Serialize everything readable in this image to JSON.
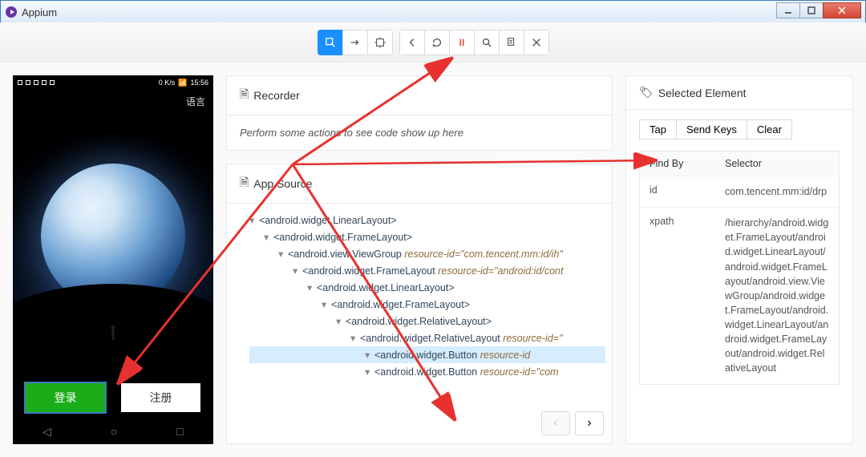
{
  "window": {
    "title": "Appium"
  },
  "toolbar": {
    "buttons": [
      {
        "name": "select-element-icon"
      },
      {
        "name": "swipe-icon"
      },
      {
        "name": "tap-coords-icon"
      },
      {
        "name": "back-icon"
      },
      {
        "name": "refresh-icon"
      },
      {
        "name": "record-icon"
      },
      {
        "name": "search-icon"
      },
      {
        "name": "copy-icon"
      },
      {
        "name": "close-session-icon"
      }
    ]
  },
  "phone": {
    "status_speed": "0 K/s",
    "status_time": "15:56",
    "lang_label": "语言",
    "login_label": "登录",
    "register_label": "注册"
  },
  "recorder": {
    "title": "Recorder",
    "empty_text": "Perform some actions to see code show up here"
  },
  "source": {
    "title": "App Source",
    "tree": [
      {
        "indent": 0,
        "tag": "<android.widget.LinearLayout>",
        "attr": ""
      },
      {
        "indent": 1,
        "tag": "<android.widget.FrameLayout>",
        "attr": ""
      },
      {
        "indent": 2,
        "tag": "<android.view.ViewGroup ",
        "attr": "resource-id=\"com.tencent.mm:id/ih\""
      },
      {
        "indent": 3,
        "tag": "<android.widget.FrameLayout ",
        "attr": "resource-id=\"android:id/cont"
      },
      {
        "indent": 4,
        "tag": "<android.widget.LinearLayout>",
        "attr": ""
      },
      {
        "indent": 5,
        "tag": "<android.widget.FrameLayout>",
        "attr": ""
      },
      {
        "indent": 6,
        "tag": "<android.widget.RelativeLayout>",
        "attr": ""
      },
      {
        "indent": 7,
        "tag": "<android.widget.RelativeLayout ",
        "attr": "resource-id=\""
      },
      {
        "indent": 8,
        "tag": "<android.widget.Button ",
        "attr": "resource-id",
        "selected": true
      },
      {
        "indent": 8,
        "tag": "<android.widget.Button ",
        "attr": "resource-id=\"com"
      }
    ]
  },
  "selected": {
    "title": "Selected Element",
    "actions": {
      "tap": "Tap",
      "send_keys": "Send Keys",
      "clear": "Clear"
    },
    "findby_h": "Find By",
    "selector_h": "Selector",
    "rows": [
      {
        "k": "id",
        "v": "com.tencent.mm:id/drp"
      },
      {
        "k": "xpath",
        "v": "/hierarchy/android.widget.FrameLayout/android.widget.LinearLayout/android.widget.FrameLayout/android.view.ViewGroup/android.widget.FrameLayout/android.widget.LinearLayout/android.widget.FrameLayout/android.widget.RelativeLayout"
      }
    ]
  }
}
